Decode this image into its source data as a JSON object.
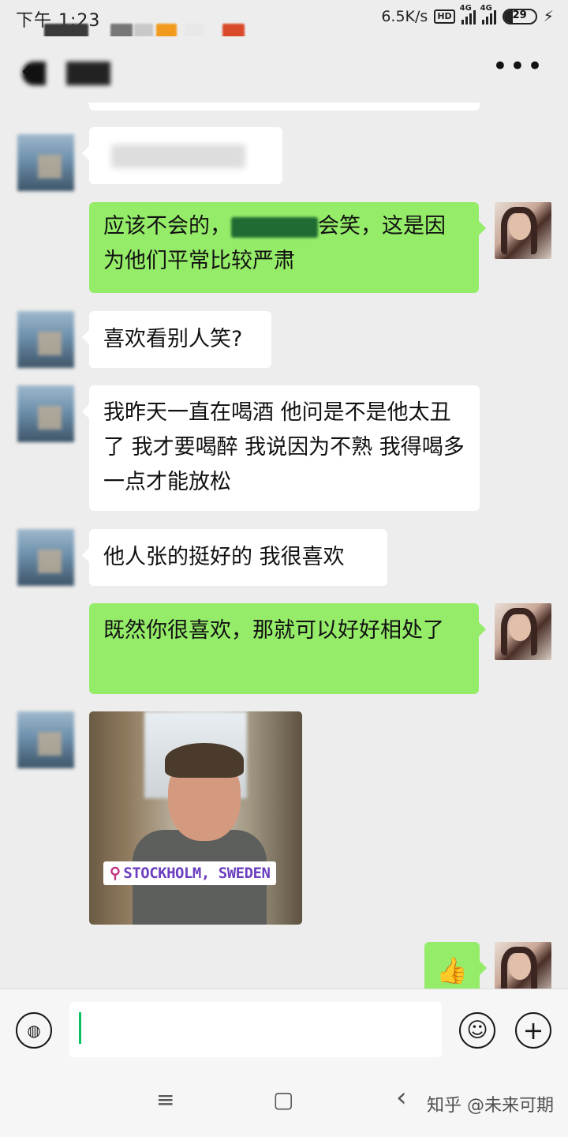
{
  "status_bar": {
    "time": "下午 1:23",
    "network_speed": "6.5K/s",
    "hd_badge": "HD",
    "signal_1_type": "4G",
    "signal_2_type": "4G",
    "battery_level": 29,
    "battery_text": "29",
    "charging_symbol": "⚡"
  },
  "nav": {
    "back_symbol": "‹",
    "more_symbol": "•••"
  },
  "messages": [
    {
      "side": "in",
      "type": "text",
      "text": ""
    },
    {
      "side": "out",
      "type": "text",
      "text_before": "应该不会的，",
      "text_after": "会笑，这是因为他们平常比较严肃"
    },
    {
      "side": "in",
      "type": "text",
      "text": "喜欢看别人笑?"
    },
    {
      "side": "in",
      "type": "text",
      "text": "我昨天一直在喝酒 他问是不是他太丑了 我才要喝醉 我说因为不熟 我得喝多一点才能放松"
    },
    {
      "side": "in",
      "type": "text",
      "text": "他人张的挺好的 我很喜欢"
    },
    {
      "side": "out",
      "type": "text",
      "text": "既然你很喜欢，那就可以好好相处了"
    },
    {
      "side": "in",
      "type": "image",
      "location_tag": "STOCKHOLM, SWEDEN",
      "pin_symbol": "⚲"
    },
    {
      "side": "out",
      "type": "emoji",
      "emoji": "👍"
    }
  ],
  "input_bar": {
    "voice_icon_symbol": "◍",
    "text_value": "",
    "emoji_icon_symbol": "☺",
    "plus_icon_symbol": "+"
  },
  "system_nav": {
    "menu_symbol": "≡",
    "home_symbol": "▢",
    "back_symbol": "‹"
  },
  "watermark": "知乎 @未来可期",
  "colors": {
    "background": "#ededed",
    "bubble_in": "#ffffff",
    "bubble_out": "#95ec69",
    "accent_green": "#07c160"
  }
}
